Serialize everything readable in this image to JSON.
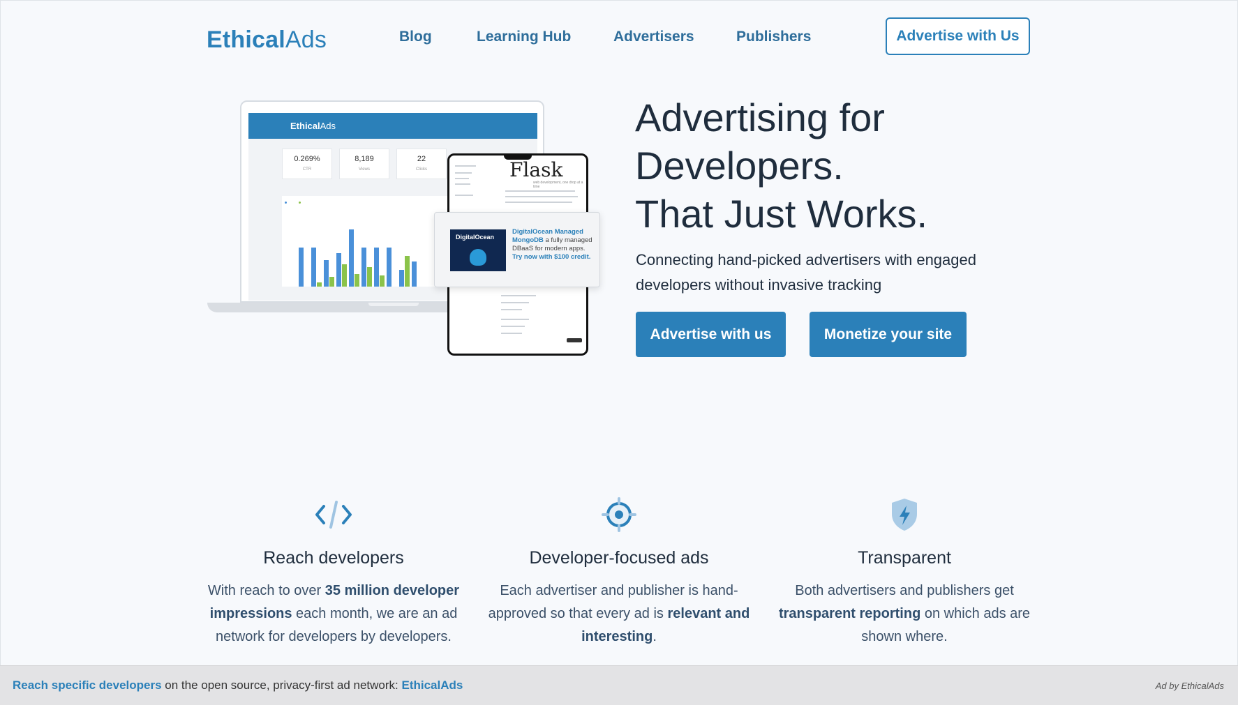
{
  "header": {
    "logo_bold": "Ethical",
    "logo_light": "Ads",
    "nav": [
      {
        "label": "Blog"
      },
      {
        "label": "Learning Hub"
      },
      {
        "label": "Advertisers"
      },
      {
        "label": "Publishers"
      }
    ],
    "cta_label": "Advertise with Us"
  },
  "hero_image": {
    "laptop_brand_bold": "Ethical",
    "laptop_brand_light": "Ads",
    "stats": [
      {
        "value": "0.269%",
        "label": "CTR"
      },
      {
        "value": "8,189",
        "label": "Views"
      },
      {
        "value": "22",
        "label": "Clicks"
      }
    ],
    "tablet_logo": "Flask",
    "tablet_tagline": "web development, one drop at a time",
    "ad": {
      "image_brand": "DigitalOcean",
      "title_link": "DigitalOcean Managed MongoDB",
      "body": " a fully managed DBaaS for modern apps. ",
      "cta_link": "Try now with $100 credit."
    }
  },
  "hero": {
    "title_lines": [
      "Advertising for",
      "Developers.",
      "That Just Works."
    ],
    "subtitle": "Connecting hand-picked advertisers with engaged developers without invasive tracking",
    "primary_button": "Advertise with us",
    "secondary_button": "Monetize your site"
  },
  "features": [
    {
      "icon": "code-icon",
      "title": "Reach developers",
      "text_parts": [
        "With reach to over ",
        "35 million developer impressions",
        " each month, we are an ad network for developers by developers."
      ]
    },
    {
      "icon": "target-icon",
      "title": "Developer-focused ads",
      "text_parts": [
        "Each advertiser and publisher is hand-approved so that every ad is ",
        "relevant and interesting",
        "."
      ]
    },
    {
      "icon": "shield-bolt-icon",
      "title": "Transparent",
      "text_parts": [
        "Both advertisers and publishers get ",
        "transparent reporting",
        " on which ads are shown where."
      ]
    }
  ],
  "footer_ad": {
    "link1": "Reach specific developers",
    "text": " on the open source, privacy-first ad network: ",
    "link2": "EthicalAds",
    "attribution": "Ad by EthicalAds"
  },
  "colors": {
    "brand_blue": "#2b80b9",
    "page_bg": "#f7f9fc",
    "chart_blue": "#4a90d9",
    "chart_green": "#8bc34a"
  }
}
